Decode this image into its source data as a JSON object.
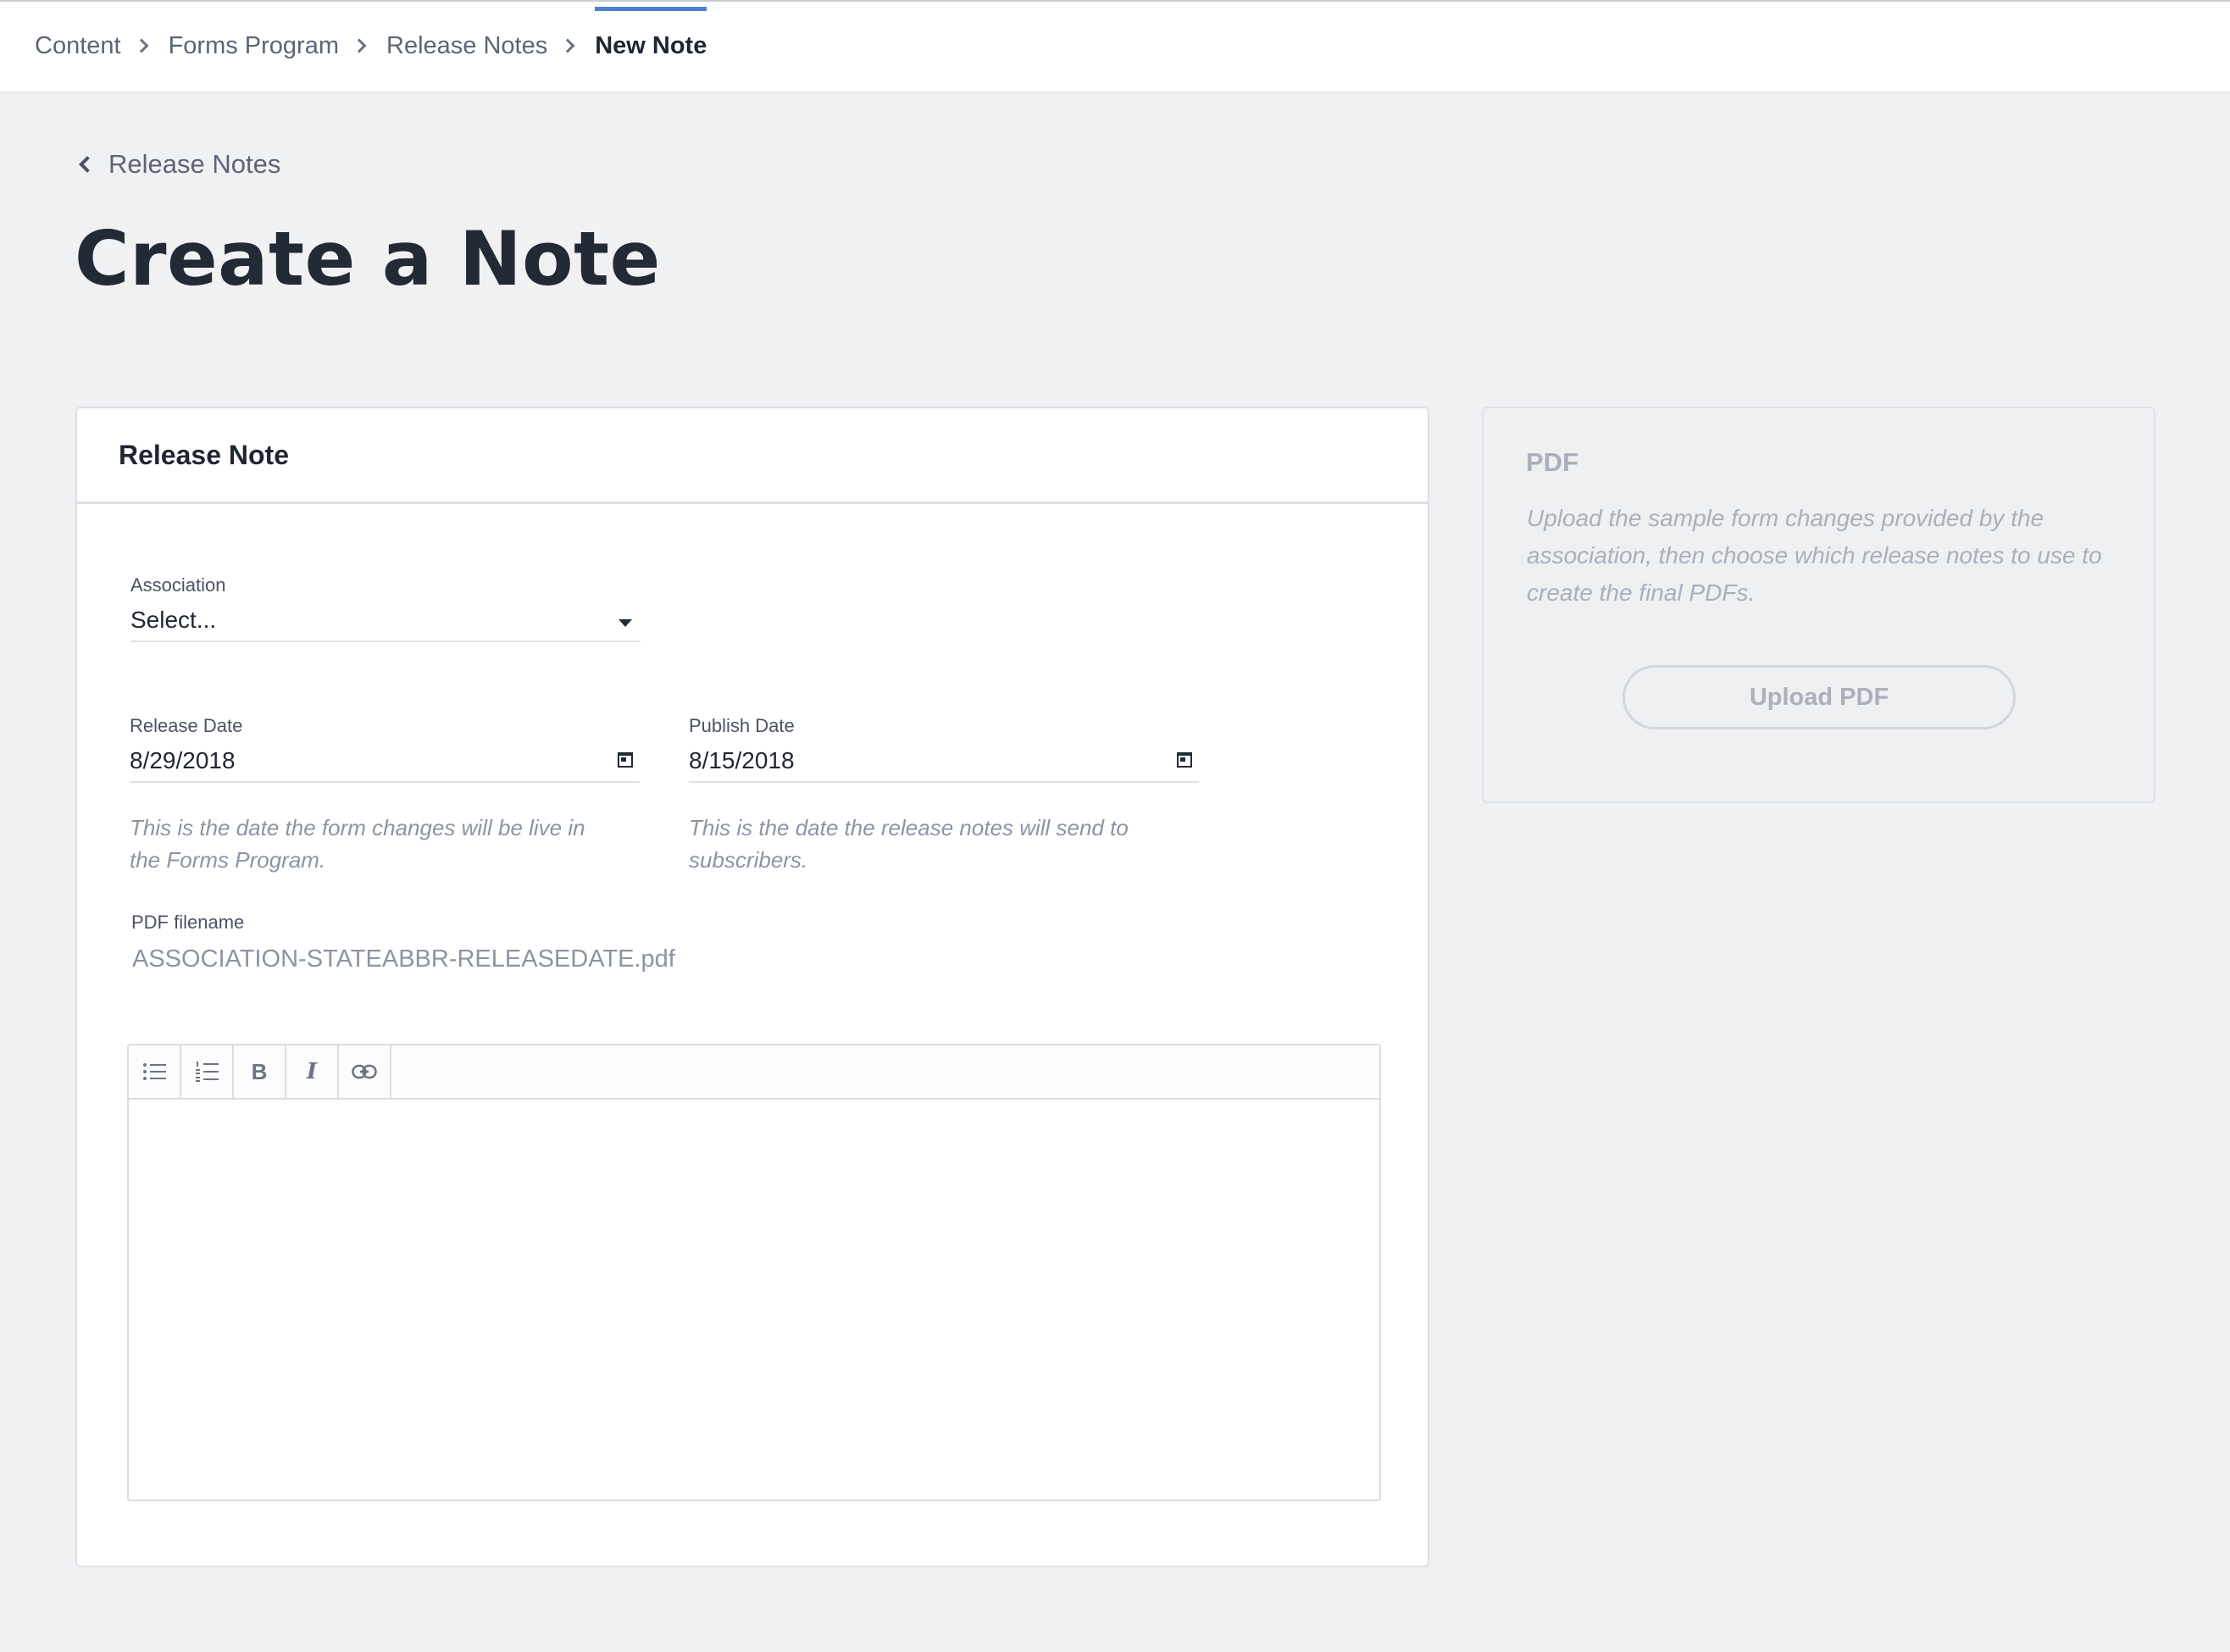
{
  "breadcrumb": {
    "items": [
      "Content",
      "Forms Program",
      "Release Notes"
    ],
    "current": "New Note"
  },
  "back_link": {
    "label": "Release Notes"
  },
  "page_title": "Create a Note",
  "release_note_card": {
    "title": "Release Note",
    "association": {
      "label": "Association",
      "value": "Select..."
    },
    "release_date": {
      "label": "Release Date",
      "value": "8/29/2018",
      "hint": "This is the date the form changes will be live in the Forms Program."
    },
    "publish_date": {
      "label": "Publish Date",
      "value": "8/15/2018",
      "hint": "This is the date the release notes will send to subscribers."
    },
    "pdf_filename": {
      "label": "PDF filename",
      "value": "ASSOCIATION-STATEABBR-RELEASEDATE.pdf"
    },
    "editor": {
      "toolbar": [
        "bulleted-list-icon",
        "numbered-list-icon",
        "bold-icon",
        "italic-icon",
        "link-icon"
      ],
      "bold_glyph": "B",
      "italic_glyph": "I",
      "content": ""
    }
  },
  "pdf_card": {
    "title": "PDF",
    "description": "Upload the sample form changes provided by the association, then choose which release notes to use to create the final PDFs.",
    "upload_label": "Upload PDF"
  },
  "colors": {
    "accent": "#4a7fd6",
    "background": "#f0f1f3",
    "text_dark": "#1f2633",
    "muted": "#8c94a3"
  }
}
